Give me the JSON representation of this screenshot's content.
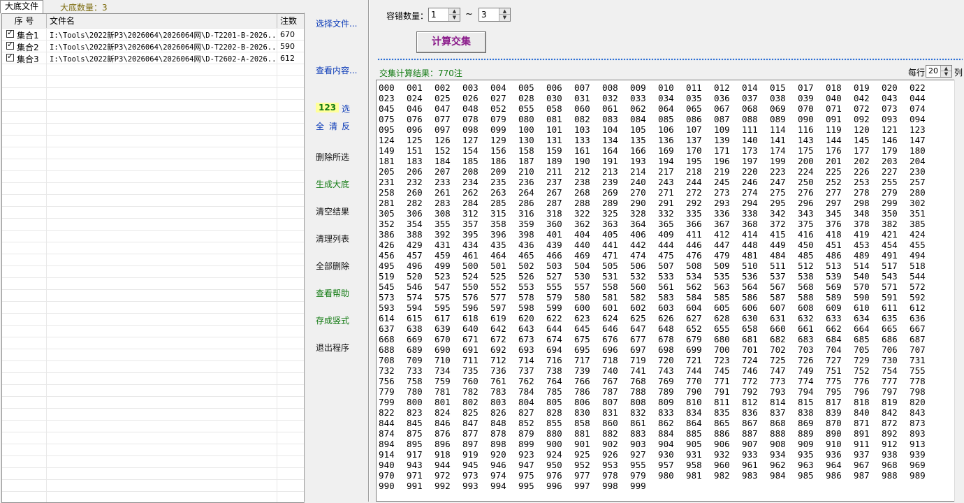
{
  "tabs": {
    "active": "大底文件",
    "count_label": "大底数量：3"
  },
  "list": {
    "headers": [
      "序 号",
      "文件名",
      "注数"
    ],
    "rows": [
      {
        "name": "集合1",
        "file": "I:\\Tools\\2022新P3\\2026064\\2026064网\\D-T2201-B-2026...",
        "count": "670",
        "checked": true
      },
      {
        "name": "集合2",
        "file": "I:\\Tools\\2022新P3\\2026064\\2026064网\\D-T2202-B-2026...",
        "count": "590",
        "checked": true
      },
      {
        "name": "集合3",
        "file": "I:\\Tools\\2022新P3\\2026064\\2026064网\\D-T2602-A-2026...",
        "count": "612",
        "checked": true
      }
    ]
  },
  "buttons": {
    "select_file": "选择文件...",
    "view_content": "查看内容...",
    "num": "123",
    "select": "选",
    "all": "全",
    "clear": "清",
    "invert": "反",
    "delete_selected": "删除所选",
    "generate": "生成大底",
    "clear_result": "清空结果",
    "clear_list": "清理列表",
    "delete_all": "全部删除",
    "help": "查看帮助",
    "save_vertical": "存成竖式",
    "exit": "退出程序"
  },
  "controls": {
    "error_label": "容错数量：",
    "min": "1",
    "tilde": "~",
    "max": "3",
    "calc": "计算交集"
  },
  "result": {
    "label": "交集计算结果：770注",
    "per_row_label": "每行",
    "per_row_value": "20",
    "col_label": "列"
  },
  "numbers": "000 001 002 003 004 005 006 007 008 009 010 011 012 014 015 017 018 019 020 022 023 024 025 026 027 028 030 031 032 033 034 035 036 037 038 039 040 042 043 044 045 046 047 048 052 055 058 060 061 062 064 065 067 068 069 070 071 072 073 074 075 076 077 078 079 080 081 082 083 084 085 086 087 088 089 090 091 092 093 094 095 096 097 098 099 100 101 103 104 105 106 107 109 111 114 116 119 120 121 123 124 125 126 127 129 130 131 133 134 135 136 137 139 140 141 143 144 145 146 147 149 151 152 154 156 158 159 161 164 166 169 170 171 173 174 175 176 177 179 180 181 183 184 185 186 187 189 190 191 193 194 195 196 197 199 200 201 202 203 204 205 206 207 208 209 210 211 212 213 214 217 218 219 220 223 224 225 226 227 230 231 232 233 234 235 236 237 238 239 240 243 244 245 246 247 250 252 253 255 257 258 260 261 262 263 264 267 268 269 270 271 272 273 274 275 276 277 278 279 280 281 282 283 284 285 286 287 288 289 290 291 292 293 294 295 296 297 298 299 302 305 306 308 312 315 316 318 322 325 328 332 335 336 338 342 343 345 348 350 351 352 354 355 357 358 359 360 362 363 364 365 366 367 368 372 375 376 378 382 385 386 388 392 395 396 398 401 404 405 406 409 411 412 414 415 416 418 419 421 424 426 429 431 434 435 436 439 440 441 442 444 446 447 448 449 450 451 453 454 455 456 457 459 461 464 465 466 469 471 474 475 476 479 481 484 485 486 489 491 494 495 496 499 500 501 502 503 504 505 506 507 508 509 510 511 512 513 514 517 518 519 520 523 524 525 526 527 530 531 532 533 534 535 536 537 538 539 540 543 544 545 546 547 550 552 553 555 557 558 560 561 562 563 564 567 568 569 570 571 572 573 574 575 576 577 578 579 580 581 582 583 584 585 586 587 588 589 590 591 592 593 594 595 596 597 598 599 600 601 602 603 604 605 606 607 608 609 610 611 612 614 615 617 618 619 620 622 623 624 625 626 627 628 630 631 632 633 634 635 636 637 638 639 640 642 643 644 645 646 647 648 652 655 658 660 661 662 664 665 667 668 669 670 671 672 673 674 675 676 677 678 679 680 681 682 683 684 685 686 687 688 689 690 691 692 693 694 695 696 697 698 699 700 701 702 703 704 705 706 707 708 709 710 711 712 714 716 717 718 719 720 721 723 724 725 726 727 729 730 731 732 733 734 735 736 737 738 739 740 741 743 744 745 746 747 749 751 752 754 755 756 758 759 760 761 762 764 766 767 768 769 770 771 772 773 774 775 776 777 778 779 780 781 782 783 784 785 786 787 788 789 790 791 792 793 794 795 796 797 798 799 800 801 802 803 804 805 806 807 808 809 810 811 812 814 815 817 818 819 820 822 823 824 825 826 827 828 830 831 832 833 834 835 836 837 838 839 840 842 843 844 845 846 847 848 852 855 858 860 861 862 864 865 867 868 869 870 871 872 873 874 875 876 877 878 879 880 881 882 883 884 885 886 887 888 889 890 891 892 893 894 895 896 897 898 899 900 901 902 903 904 905 906 907 908 909 910 911 912 913 914 917 918 919 920 923 924 925 926 927 930 931 932 933 934 935 936 937 938 939 940 943 944 945 946 947 950 952 953 955 957 958 960 961 962 963 964 967 968 969 970 971 972 973 974 975 976 977 978 979 980 981 982 983 984 985 986 987 988 989 990 991 992 993 994 995 996 997 998 999",
  "colors": {
    "accent_blue": "#0d3cb8",
    "accent_green": "#117a11",
    "calc_text": "#8a1a8a"
  }
}
